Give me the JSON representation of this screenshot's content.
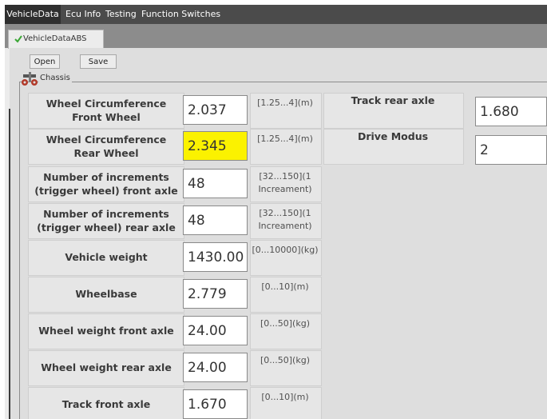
{
  "menu": [
    {
      "label": "VehicleData",
      "active": true
    },
    {
      "label": "Ecu Info",
      "active": false
    },
    {
      "label": "Testing",
      "active": false
    },
    {
      "label": "Function Switches",
      "active": false
    }
  ],
  "tab": {
    "label": "VehicleDataABS",
    "icon": "checkmark-icon"
  },
  "toolbar": {
    "open_label": "Open",
    "save_label": "Save"
  },
  "group": {
    "title": "Chassis",
    "icon": "chassis-icon"
  },
  "fields_left": [
    {
      "label": "Wheel Circumference Front Wheel",
      "value": "2.037",
      "range": "[1.25...4](m)",
      "highlight": false
    },
    {
      "label": "Wheel Circumference Rear Wheel",
      "value": "2.345",
      "range": "[1.25...4](m)",
      "highlight": true
    },
    {
      "label": "Number of increments (trigger wheel) front axle",
      "value": "48",
      "range": "[32...150](1 Increament)",
      "highlight": false
    },
    {
      "label": "Number of increments (trigger wheel) rear axle",
      "value": "48",
      "range": "[32...150](1 Increament)",
      "highlight": false
    },
    {
      "label": "Vehicle weight",
      "value": "1430.00",
      "range": "[0...10000](kg)",
      "highlight": false
    },
    {
      "label": "Wheelbase",
      "value": "2.779",
      "range": "[0...10](m)",
      "highlight": false
    },
    {
      "label": "Wheel weight front axle",
      "value": "24.00",
      "range": "[0...50](kg)",
      "highlight": false
    },
    {
      "label": "Wheel weight rear axle",
      "value": "24.00",
      "range": "[0...50](kg)",
      "highlight": false
    },
    {
      "label": "Track front axle",
      "value": "1.670",
      "range": "[0...10](m)",
      "highlight": false
    }
  ],
  "fields_right": [
    {
      "label": "Track rear axle",
      "value": "1.680"
    },
    {
      "label": "Drive Modus",
      "value": "2"
    }
  ],
  "colors": {
    "menubar": "#4b4b4b",
    "tabstrip": "#8c8c8c",
    "highlight": "#fbf200",
    "panel": "#dedede"
  }
}
